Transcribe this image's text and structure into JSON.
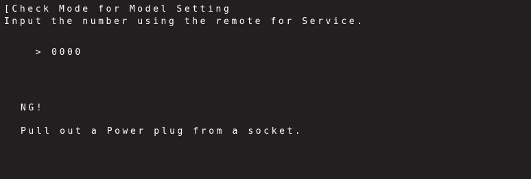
{
  "screen": {
    "title": "[Check Mode for Model Setting",
    "instruction": "Input the number using the remote for Service.",
    "prompt_symbol": ">",
    "input_value": "0000",
    "result": "NG!",
    "message": "Pull out a Power plug from a socket."
  },
  "colors": {
    "background": "#231f20",
    "text": "#ffffff"
  }
}
